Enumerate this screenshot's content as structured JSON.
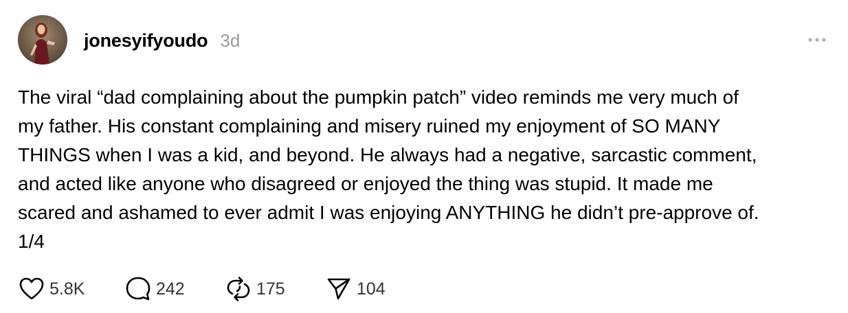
{
  "post": {
    "username": "jonesyifyoudo",
    "timestamp": "3d",
    "more_icon": "more-horizontal-icon",
    "text": "The viral “dad complaining about the pumpkin patch” video reminds me very much of\nmy father. His constant complaining and misery ruined my enjoyment of SO MANY\nTHINGS when I was a kid, and beyond. He always had a negative, sarcastic comment,\nand acted like anyone who disagreed or enjoyed the thing was stupid. It made me\nscared and ashamed to ever admit I was enjoying ANYTHING he didn’t pre-approve of.\n1/4",
    "actions": {
      "likes": {
        "icon": "heart-icon",
        "count": "5.8K"
      },
      "comments": {
        "icon": "comment-bubble-icon",
        "count": "242"
      },
      "reposts": {
        "icon": "repost-icon",
        "count": "175"
      },
      "shares": {
        "icon": "send-icon",
        "count": "104"
      }
    }
  },
  "colors": {
    "text": "#000000",
    "muted": "#999999",
    "icon": "#000000"
  }
}
